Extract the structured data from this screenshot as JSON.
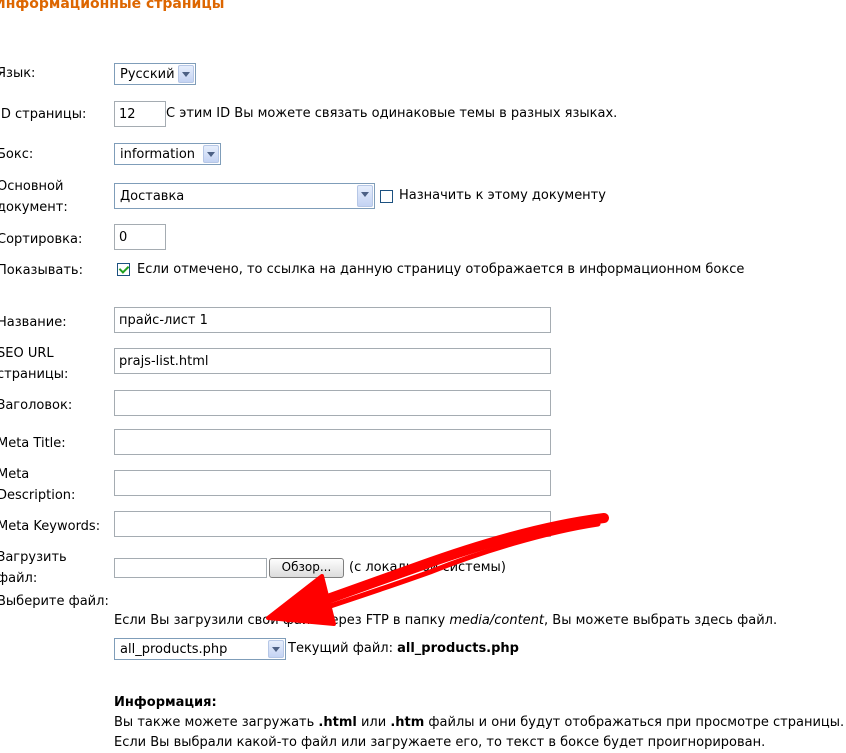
{
  "header": {
    "title": "Информационные страницы",
    "title_color": "#dd6600"
  },
  "form": {
    "language": {
      "label": "Язык:",
      "value": "Русский"
    },
    "page_id": {
      "label": "ID страницы:",
      "value": "12",
      "hint": "С этим ID Вы можете связать одинаковые темы в разных языках."
    },
    "box": {
      "label": "Бокс:",
      "value": "information"
    },
    "main_document": {
      "label_line1": "Основной",
      "label_line2": "документ:",
      "value": "Доставка",
      "assign_label": "Назначить к этому документу",
      "assign_checked": false
    },
    "sort": {
      "label": "Сортировка:",
      "value": "0"
    },
    "show": {
      "label": "Показывать:",
      "checked": true,
      "text": "Если отмечено, то ссылка на данную страницу отображается в информационном боксе"
    },
    "name": {
      "label": "Название:",
      "value": "прайс-лист 1"
    },
    "seo_url": {
      "label_line1": "SEO URL",
      "label_line2": "страницы:",
      "value": "prajs-list.html"
    },
    "heading": {
      "label": "Заголовок:",
      "value": ""
    },
    "meta_title": {
      "label": "Meta Title:",
      "value": ""
    },
    "meta_description": {
      "label_line1": "Meta",
      "label_line2": "Description:",
      "value": ""
    },
    "meta_keywords": {
      "label": "Meta Keywords:",
      "value": ""
    },
    "upload": {
      "label_line1": "Загрузить",
      "label_line2": "файл:",
      "browse_label": "Обзор...",
      "local_text": "(с локальной системы)"
    },
    "choose_file": {
      "label": "Выберите файл:",
      "desc_pre": "Если Вы загрузили свой файл через FTP в папку ",
      "desc_folder": "media/content",
      "desc_post": ", Вы можете выбрать здесь файл.",
      "value": "all_products.php",
      "current_label": "Текущий файл:",
      "current_value": "all_products.php"
    },
    "info": {
      "title": "Информация:",
      "line1_pre": "Вы также можете загружать ",
      "ext1": ".html",
      "line1_mid": " или ",
      "ext2": ".htm",
      "line1_post": " файлы и они будут отображаться при просмотре страницы.",
      "line2": "Если Вы выбрали какой-то файл или загружаете его, то текст в боксе будет проигнорирован."
    }
  },
  "annotation": {
    "arrow_color": "#ff0000"
  }
}
